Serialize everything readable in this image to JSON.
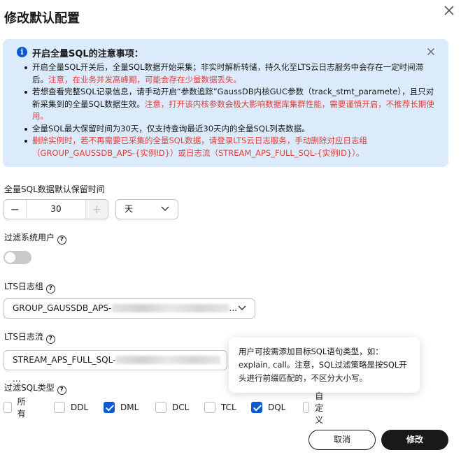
{
  "dialog": {
    "title": "修改默认配置"
  },
  "notice": {
    "title": "开启全量SQL的注意事项：",
    "items": [
      {
        "text": "开启全量SQL开关后，全量SQL数据开始采集；非实时解析转储，持久化至LTS云日志服务中会存在一定时间滞后。",
        "warn": "注意，在业务并发高峰期，可能会存在少量数据丢失。"
      },
      {
        "text": "若想查看完整SQL记录信息，请手动开启“参数追踪”GaussDB内核GUC参数（track_stmt_paramete），且只对新采集到的全量SQL数据生效。",
        "warn": "注意，打开该内核参数会极大影响数据库集群性能，需要谨慎开启，不推荐长期使用。"
      },
      {
        "text": "全量SQL最大保留时间为30天，仅支持查询最近30天内的全量SQL列表数据。"
      },
      {
        "warn": "删除实例时，若不再需要已采集的全量SQL数据，请登录LTS云日志服务，手动删除对应日志组（GROUP_GAUSSDB_APS-{实例ID}）或日志流（STREAM_APS_FULL_SQL-{实例ID}）。"
      }
    ]
  },
  "retention": {
    "label": "全量SQL数据默认保留时间",
    "value": "30",
    "minus": "−",
    "plus": "+",
    "unit": "天"
  },
  "filter_system": {
    "label": "过滤系统用户",
    "enabled": false
  },
  "lts_group": {
    "label": "LTS日志组",
    "value_prefix": "GROUP_GAUSSDB_APS-",
    "value_suffix": "..."
  },
  "lts_stream": {
    "label": "LTS日志流",
    "value_prefix": "STREAM_APS_FULL_SQL-",
    "value_suffix": "..."
  },
  "tooltip": {
    "text": "用户可按需添加目标SQL语句类型，如：explain, call。注意，SQL过滤策略是按SQL开头进行前缀匹配的，不区分大小写。"
  },
  "sql_types": {
    "label": "过滤SQL类型",
    "options": [
      {
        "label": "所有",
        "checked": false
      },
      {
        "label": "DDL",
        "checked": false
      },
      {
        "label": "DML",
        "checked": true
      },
      {
        "label": "DCL",
        "checked": false
      },
      {
        "label": "TCL",
        "checked": false
      },
      {
        "label": "DQL",
        "checked": true
      },
      {
        "label": "自定义",
        "checked": false
      }
    ]
  },
  "footer": {
    "cancel": "取消",
    "submit": "修改"
  },
  "colors": {
    "accent": "#0a58d6",
    "notice_bg": "#dbebfb",
    "warn": "#e03d3d",
    "primary_button": "#191919"
  },
  "icons": [
    "close-icon",
    "info-icon",
    "help-icon",
    "chevron-down-icon",
    "check-icon"
  ]
}
